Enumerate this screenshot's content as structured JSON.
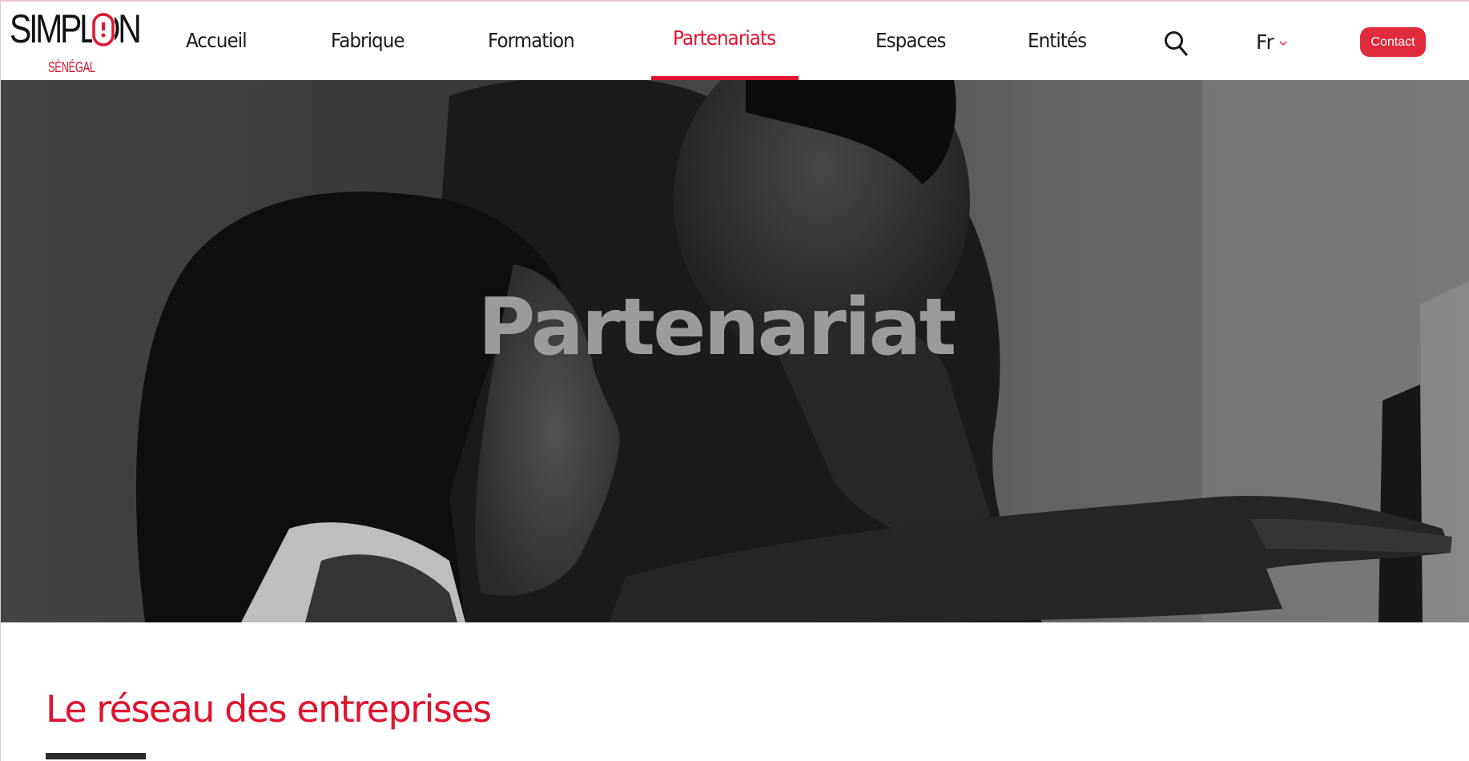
{
  "brand": {
    "wordmark": "SIMPLON",
    "subtitle": "SÉNÉGAL",
    "accent_color": "#e1132f"
  },
  "nav": {
    "items": [
      {
        "label": "Accueil"
      },
      {
        "label": "Fabrique"
      },
      {
        "label": "Formation"
      },
      {
        "label": "Partenariats",
        "active": true
      },
      {
        "label": "Espaces"
      },
      {
        "label": "Entités"
      }
    ],
    "search_icon": "search-icon",
    "language": {
      "selected": "Fr",
      "icon": "chevron-down-icon"
    },
    "contact_label": "Contact",
    "contact_color": "#e12a3c"
  },
  "hero": {
    "title": "Partenariat",
    "image": "grayscale photo of two people looking at a computer screen"
  },
  "section": {
    "title": "Le réseau des entreprises"
  }
}
